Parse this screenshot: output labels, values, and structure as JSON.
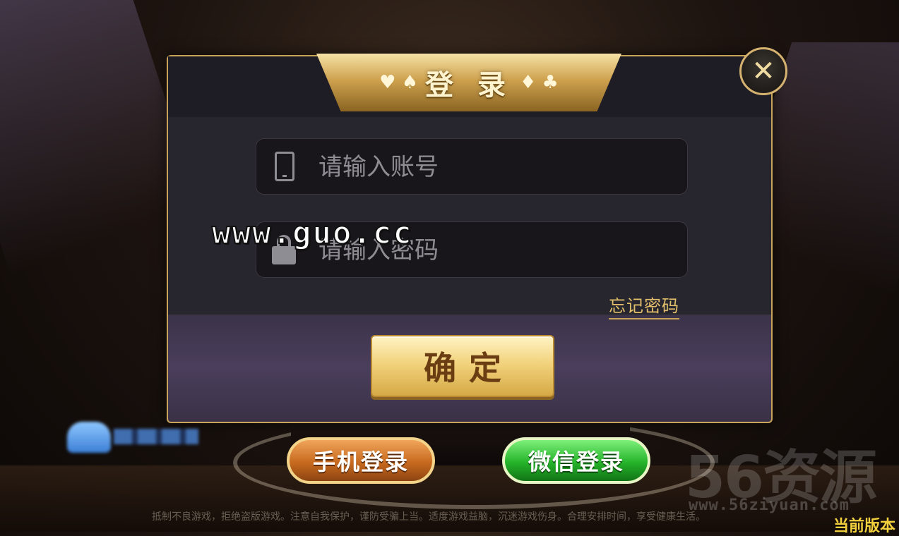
{
  "dialog": {
    "title": "登 录",
    "title_suits_left": "♥ ♠",
    "title_suits_right": "♦ ♣",
    "close_label": "✕",
    "account_placeholder": "请输入账号",
    "password_placeholder": "请输入密码",
    "account_icon": "phone-icon",
    "password_icon": "lock-icon",
    "forgot_label": "忘记密码",
    "confirm_label": "确定"
  },
  "login_options": {
    "phone_label": "手机登录",
    "wechat_label": "微信登录"
  },
  "overlay_watermark": "www.guo.cc",
  "footer": {
    "notice": "抵制不良游戏，拒绝盗版游戏。注意自我保护，谨防受骗上当。适度游戏益脑，沉迷游戏伤身。合理安排时间，享受健康生活。",
    "version_label": "当前版本"
  },
  "corner_brand": {
    "name": "56资源",
    "url": "www.56ziyuan.com"
  },
  "colors": {
    "gold": "#c9a35a",
    "confirm_text": "#6a3e12",
    "wechat_green": "#25b32a",
    "phone_orange": "#c76a1f",
    "version_yellow": "#f3d03e"
  }
}
